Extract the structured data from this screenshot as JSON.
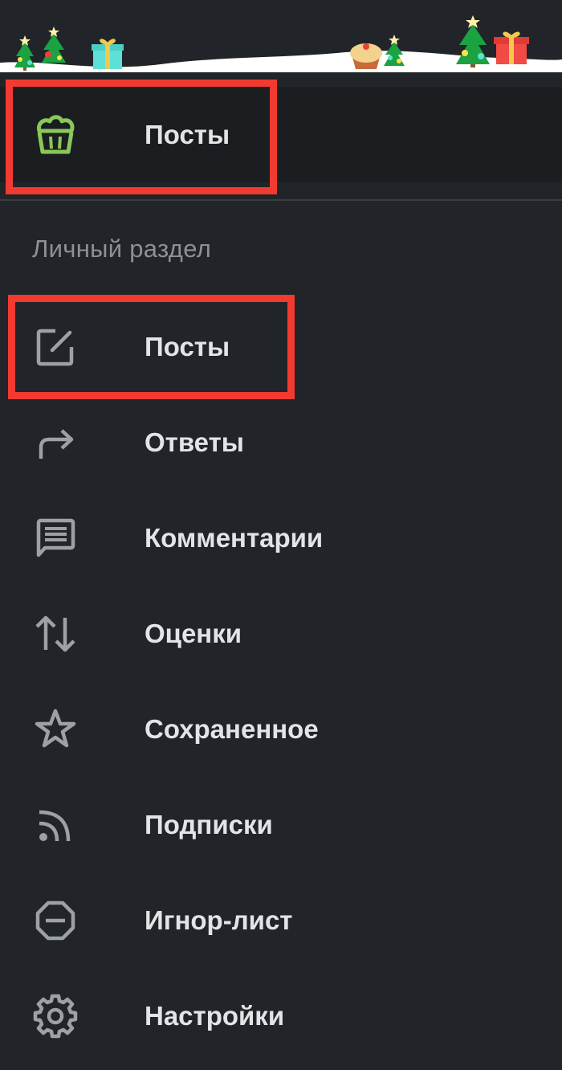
{
  "header": {
    "decoration": "christmas-garland",
    "colors": {
      "background": "#212429",
      "snow": "#ffffff",
      "tree": "#1aa340",
      "star": "#fff1a8",
      "gift_teal": "#5ee0d8",
      "gift_red": "#f24a44"
    }
  },
  "active_item": {
    "label": "Посты",
    "icon": "basket-icon",
    "color": "#8ac858"
  },
  "section": {
    "title": "Личный раздел"
  },
  "menu": {
    "posts": {
      "label": "Посты",
      "icon": "edit-icon"
    },
    "replies": {
      "label": "Ответы",
      "icon": "reply-arrow-icon"
    },
    "comments": {
      "label": "Комментарии",
      "icon": "comment-icon"
    },
    "ratings": {
      "label": "Оценки",
      "icon": "sort-arrows-icon"
    },
    "saved": {
      "label": "Сохраненное",
      "icon": "star-icon"
    },
    "subscriptions": {
      "label": "Подписки",
      "icon": "rss-icon"
    },
    "ignore_list": {
      "label": "Игнор-лист",
      "icon": "block-icon"
    },
    "settings": {
      "label": "Настройки",
      "icon": "gear-icon"
    }
  },
  "highlight_color": "#f23a31"
}
